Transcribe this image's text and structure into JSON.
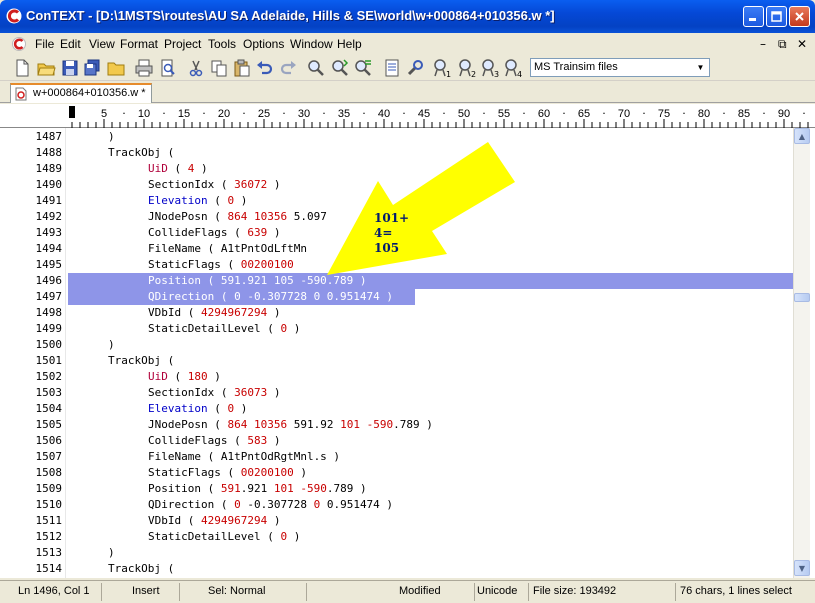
{
  "window": {
    "title": "ConTEXT - [D:\\1MSTS\\routes\\AU SA Adelaide, Hills & SE\\world\\w+000864+010356.w *]"
  },
  "menu": {
    "items": [
      "File",
      "Edit",
      "View",
      "Format",
      "Project",
      "Tools",
      "Options",
      "Window",
      "Help"
    ]
  },
  "toolbar": {
    "highlighter": "MS Trainsim files"
  },
  "tabs": [
    {
      "label": "w+000864+010356.w *"
    }
  ],
  "ruler": {
    "labels": [
      "5",
      "10",
      "15",
      "20",
      "25",
      "30",
      "35",
      "40",
      "45",
      "50",
      "55",
      "60",
      "65",
      "70",
      "75",
      "80",
      "85",
      "90"
    ]
  },
  "editor": {
    "lines": [
      {
        "n": "1487",
        "indent": 1,
        "tokens": [
          {
            "t": ")",
            "c": "plain"
          }
        ]
      },
      {
        "n": "1488",
        "indent": 1,
        "tokens": [
          {
            "t": "TrackObj ( ",
            "c": "plain"
          }
        ]
      },
      {
        "n": "1489",
        "indent": 2,
        "tokens": [
          {
            "t": "UiD",
            "c": "key"
          },
          {
            "t": " ( ",
            "c": "plain"
          },
          {
            "t": "4",
            "c": "val"
          },
          {
            "t": " )",
            "c": "plain"
          }
        ]
      },
      {
        "n": "1490",
        "indent": 2,
        "tokens": [
          {
            "t": "SectionIdx ( ",
            "c": "plain"
          },
          {
            "t": "36072",
            "c": "val"
          },
          {
            "t": " )",
            "c": "plain"
          }
        ]
      },
      {
        "n": "1491",
        "indent": 2,
        "tokens": [
          {
            "t": "Elevation",
            "c": "blue"
          },
          {
            "t": " ( ",
            "c": "plain"
          },
          {
            "t": "0",
            "c": "val"
          },
          {
            "t": " )",
            "c": "plain"
          }
        ]
      },
      {
        "n": "1492",
        "indent": 2,
        "tokens": [
          {
            "t": "JNodePosn ( ",
            "c": "plain"
          },
          {
            "t": "864 10356 ",
            "c": "val"
          },
          {
            "t": "5.097",
            "c": "plain"
          },
          {
            "t": "          ",
            "c": "plain"
          },
          {
            "t": "0",
            "c": "val"
          },
          {
            "t": " )",
            "c": "plain"
          }
        ]
      },
      {
        "n": "1493",
        "indent": 2,
        "tokens": [
          {
            "t": "CollideFlags ( ",
            "c": "plain"
          },
          {
            "t": "639",
            "c": "val"
          },
          {
            "t": " )",
            "c": "plain"
          }
        ]
      },
      {
        "n": "1494",
        "indent": 2,
        "tokens": [
          {
            "t": "FileName ( A1tPntOdLftMn",
            "c": "plain"
          }
        ]
      },
      {
        "n": "1495",
        "indent": 2,
        "tokens": [
          {
            "t": "StaticFlags ( ",
            "c": "plain"
          },
          {
            "t": "00200100",
            "c": "val"
          }
        ]
      },
      {
        "n": "1496",
        "indent": 2,
        "sel": true,
        "tokens": [
          {
            "t": "Position ( 591.921 105 -590.789 )",
            "c": "sel"
          }
        ]
      },
      {
        "n": "1497",
        "indent": 2,
        "sel": true,
        "partial": true,
        "tokens": [
          {
            "t": "QDirection ( 0 -0.307728 0 0.951474 )",
            "c": "sel"
          }
        ]
      },
      {
        "n": "1498",
        "indent": 2,
        "tokens": [
          {
            "t": "VDbId ( ",
            "c": "plain"
          },
          {
            "t": "4294967294",
            "c": "val"
          },
          {
            "t": " )",
            "c": "plain"
          }
        ]
      },
      {
        "n": "1499",
        "indent": 2,
        "tokens": [
          {
            "t": "StaticDetailLevel ( ",
            "c": "plain"
          },
          {
            "t": "0",
            "c": "val"
          },
          {
            "t": " )",
            "c": "plain"
          }
        ]
      },
      {
        "n": "1500",
        "indent": 1,
        "tokens": [
          {
            "t": ")",
            "c": "plain"
          }
        ]
      },
      {
        "n": "1501",
        "indent": 1,
        "tokens": [
          {
            "t": "TrackObj (",
            "c": "plain"
          }
        ]
      },
      {
        "n": "1502",
        "indent": 2,
        "tokens": [
          {
            "t": "UiD",
            "c": "key"
          },
          {
            "t": " ( ",
            "c": "plain"
          },
          {
            "t": "180",
            "c": "val"
          },
          {
            "t": " )",
            "c": "plain"
          }
        ]
      },
      {
        "n": "1503",
        "indent": 2,
        "tokens": [
          {
            "t": "SectionIdx ( ",
            "c": "plain"
          },
          {
            "t": "36073",
            "c": "val"
          },
          {
            "t": " )",
            "c": "plain"
          }
        ]
      },
      {
        "n": "1504",
        "indent": 2,
        "tokens": [
          {
            "t": "Elevation",
            "c": "blue"
          },
          {
            "t": " ( ",
            "c": "plain"
          },
          {
            "t": "0",
            "c": "val"
          },
          {
            "t": " )",
            "c": "plain"
          }
        ]
      },
      {
        "n": "1505",
        "indent": 2,
        "tokens": [
          {
            "t": "JNodePosn ( ",
            "c": "plain"
          },
          {
            "t": "864 10356 ",
            "c": "val"
          },
          {
            "t": "591.92 ",
            "c": "plain"
          },
          {
            "t": "101",
            "c": "val"
          },
          {
            "t": " ",
            "c": "plain"
          },
          {
            "t": "-590",
            "c": "val"
          },
          {
            "t": ".789 )",
            "c": "plain"
          }
        ]
      },
      {
        "n": "1506",
        "indent": 2,
        "tokens": [
          {
            "t": "CollideFlags ( ",
            "c": "plain"
          },
          {
            "t": "583",
            "c": "val"
          },
          {
            "t": " )",
            "c": "plain"
          }
        ]
      },
      {
        "n": "1507",
        "indent": 2,
        "tokens": [
          {
            "t": "FileName ( A1tPntOdRgtMnl.s )",
            "c": "plain"
          }
        ]
      },
      {
        "n": "1508",
        "indent": 2,
        "tokens": [
          {
            "t": "StaticFlags ( ",
            "c": "plain"
          },
          {
            "t": "00200100",
            "c": "val"
          },
          {
            "t": " )",
            "c": "plain"
          }
        ]
      },
      {
        "n": "1509",
        "indent": 2,
        "tokens": [
          {
            "t": "Position ( ",
            "c": "plain"
          },
          {
            "t": "591",
            "c": "val"
          },
          {
            "t": ".921 ",
            "c": "plain"
          },
          {
            "t": "101",
            "c": "val"
          },
          {
            "t": " ",
            "c": "plain"
          },
          {
            "t": "-590",
            "c": "val"
          },
          {
            "t": ".789 )",
            "c": "plain"
          }
        ]
      },
      {
        "n": "1510",
        "indent": 2,
        "tokens": [
          {
            "t": "QDirection ( ",
            "c": "plain"
          },
          {
            "t": "0",
            "c": "val"
          },
          {
            "t": " -0.307728 ",
            "c": "plain"
          },
          {
            "t": "0",
            "c": "val"
          },
          {
            "t": " 0.951474 )",
            "c": "plain"
          }
        ]
      },
      {
        "n": "1511",
        "indent": 2,
        "tokens": [
          {
            "t": "VDbId ( ",
            "c": "plain"
          },
          {
            "t": "4294967294",
            "c": "val"
          },
          {
            "t": " )",
            "c": "plain"
          }
        ]
      },
      {
        "n": "1512",
        "indent": 2,
        "tokens": [
          {
            "t": "StaticDetailLevel ( ",
            "c": "plain"
          },
          {
            "t": "0",
            "c": "val"
          },
          {
            "t": " )",
            "c": "plain"
          }
        ]
      },
      {
        "n": "1513",
        "indent": 1,
        "tokens": [
          {
            "t": ")",
            "c": "plain"
          }
        ]
      },
      {
        "n": "1514",
        "indent": 1,
        "tokens": [
          {
            "t": "TrackObj (",
            "c": "plain"
          }
        ]
      }
    ]
  },
  "annotation": {
    "lines": [
      "101+",
      "4=",
      "105"
    ],
    "arrow_color": "#ffff00"
  },
  "statusbar": {
    "position": "Ln 1496, Col 1",
    "mode": "Insert",
    "sel": "Sel: Normal",
    "modified": "Modified",
    "encoding": "Unicode",
    "filesize": "File size: 193492",
    "selinfo": "76 chars, 1 lines select"
  },
  "colors": {
    "selection": "#8e95e8",
    "keyword": "#b0003a",
    "blue_keyword": "#0000c8",
    "number": "#c80000"
  }
}
